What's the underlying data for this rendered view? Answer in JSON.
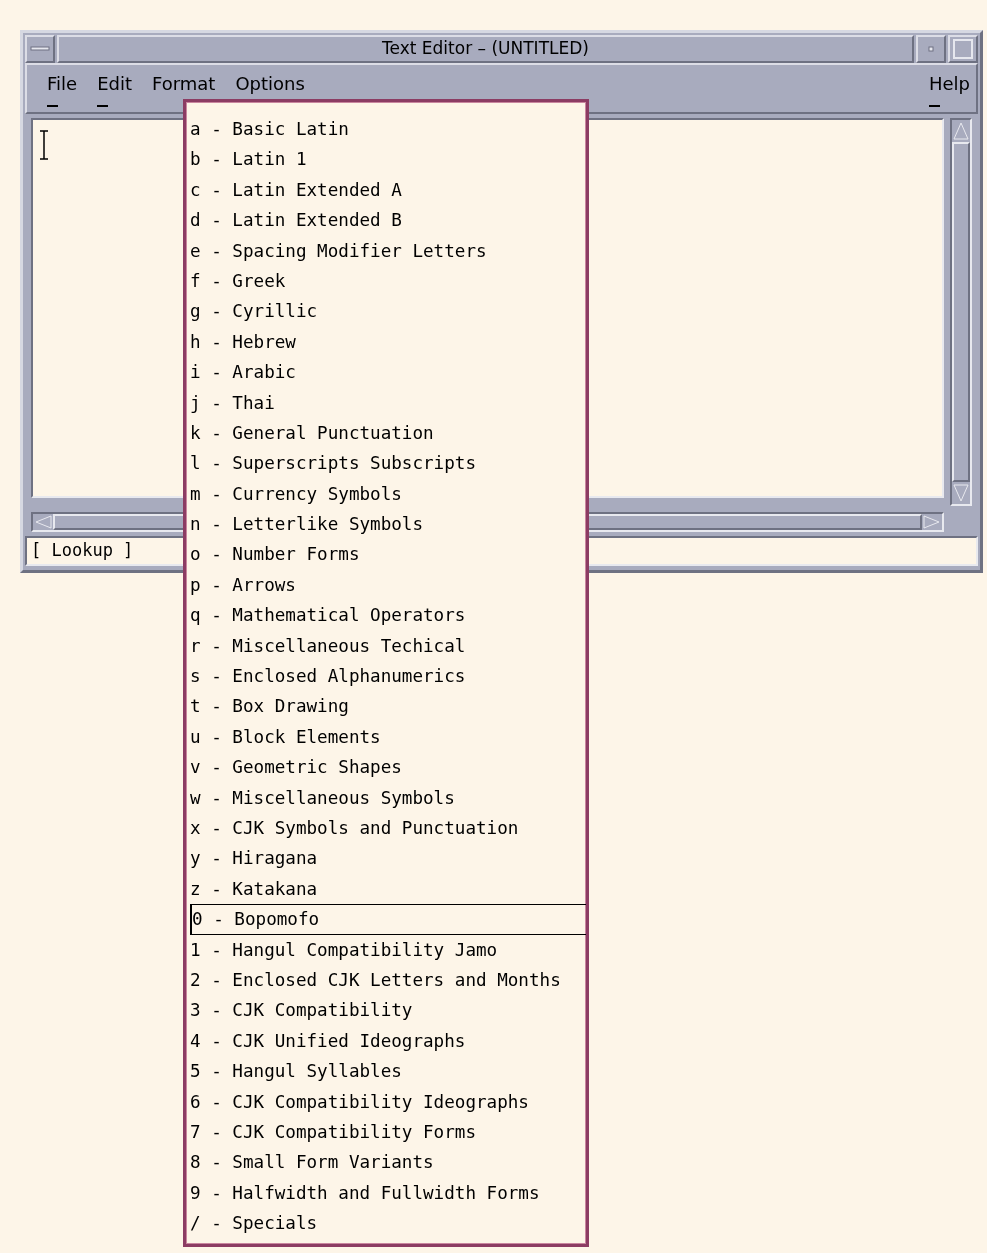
{
  "window": {
    "title": "Text Editor – (UNTITLED)"
  },
  "menu_bar": [
    {
      "label": "File",
      "mnemonic": true
    },
    {
      "label": "Edit",
      "mnemonic": true
    },
    {
      "label": "Format",
      "mnemonic": false
    },
    {
      "label": "Options",
      "mnemonic": false
    },
    {
      "label": "Help",
      "mnemonic": true
    }
  ],
  "lookup": {
    "label": "[ Lookup ]"
  },
  "dropdown": [
    {
      "label": "a - Basic Latin",
      "selected": false
    },
    {
      "label": "b - Latin 1",
      "selected": false
    },
    {
      "label": "c - Latin Extended A",
      "selected": false
    },
    {
      "label": "d - Latin Extended B",
      "selected": false
    },
    {
      "label": "e - Spacing Modifier Letters",
      "selected": false
    },
    {
      "label": "f - Greek",
      "selected": false
    },
    {
      "label": "g - Cyrillic",
      "selected": false
    },
    {
      "label": "h - Hebrew",
      "selected": false
    },
    {
      "label": "i - Arabic",
      "selected": false
    },
    {
      "label": "j - Thai",
      "selected": false
    },
    {
      "label": "k - General Punctuation",
      "selected": false
    },
    {
      "label": "l - Superscripts Subscripts",
      "selected": false
    },
    {
      "label": "m - Currency Symbols",
      "selected": false
    },
    {
      "label": "n - Letterlike Symbols",
      "selected": false
    },
    {
      "label": "o - Number Forms",
      "selected": false
    },
    {
      "label": "p - Arrows",
      "selected": false
    },
    {
      "label": "q - Mathematical Operators",
      "selected": false
    },
    {
      "label": "r - Miscellaneous Techical",
      "selected": false
    },
    {
      "label": "s - Enclosed Alphanumerics",
      "selected": false
    },
    {
      "label": "t - Box Drawing",
      "selected": false
    },
    {
      "label": "u - Block Elements",
      "selected": false
    },
    {
      "label": "v - Geometric Shapes",
      "selected": false
    },
    {
      "label": "w - Miscellaneous Symbols",
      "selected": false
    },
    {
      "label": "x - CJK Symbols and Punctuation",
      "selected": false
    },
    {
      "label": "y - Hiragana",
      "selected": false
    },
    {
      "label": "z - Katakana",
      "selected": false
    },
    {
      "label": "0 - Bopomofo",
      "selected": true
    },
    {
      "label": "1 - Hangul Compatibility Jamo",
      "selected": false
    },
    {
      "label": "2 - Enclosed CJK Letters and Months",
      "selected": false
    },
    {
      "label": "3 - CJK Compatibility",
      "selected": false
    },
    {
      "label": "4 - CJK Unified Ideographs",
      "selected": false
    },
    {
      "label": "5 - Hangul Syllables",
      "selected": false
    },
    {
      "label": "6 - CJK Compatibility Ideographs",
      "selected": false
    },
    {
      "label": "7 - CJK Compatibility Forms",
      "selected": false
    },
    {
      "label": "8 - Small Form Variants",
      "selected": false
    },
    {
      "label": "9 - Halfwidth and Fullwidth Forms",
      "selected": false
    },
    {
      "label": "/ - Specials",
      "selected": false
    }
  ]
}
